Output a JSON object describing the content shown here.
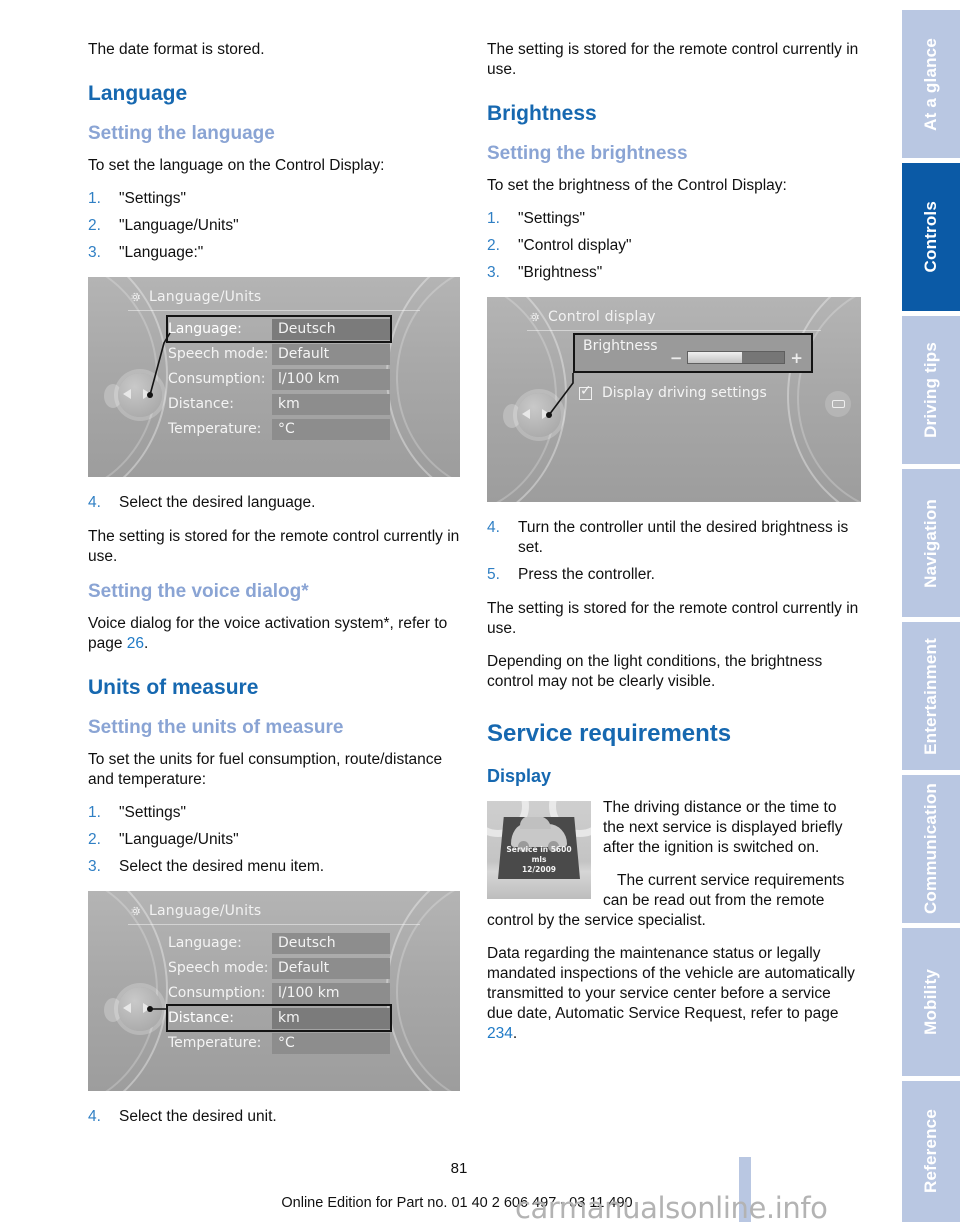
{
  "page_number": "81",
  "edition_line": "Online Edition for Part no. 01 40 2 606 497 - 03 11 490",
  "watermark": "carmanualsonline.info",
  "colors": {
    "heading_blue": "#1668b0",
    "subheading_light_blue": "#8aa4d4",
    "tab_inactive": "#b9c7e2",
    "tab_active": "#0b5aa6",
    "step_number": "#2f7fc4",
    "page_ref_link": "#1f7ac6"
  },
  "tabs": [
    {
      "label": "At a glance",
      "active": false
    },
    {
      "label": "Controls",
      "active": true
    },
    {
      "label": "Driving tips",
      "active": false
    },
    {
      "label": "Navigation",
      "active": false
    },
    {
      "label": "Entertainment",
      "active": false
    },
    {
      "label": "Communication",
      "active": false
    },
    {
      "label": "Mobility",
      "active": false
    },
    {
      "label": "Reference",
      "active": false
    }
  ],
  "left_column": {
    "intro": "The date format is stored.",
    "language_heading": "Language",
    "setting_language_heading": "Setting the language",
    "setting_language_lead": "To set the language on the Control Display:",
    "setting_language_steps": [
      {
        "num": "1.",
        "text": "\"Settings\""
      },
      {
        "num": "2.",
        "text": "\"Language/Units\""
      },
      {
        "num": "3.",
        "text": "\"Language:\""
      }
    ],
    "figure1": {
      "title": "Language/Units",
      "icon": "gear-icon",
      "rows": [
        {
          "label": "Language:",
          "value": "Deutsch",
          "selected": true
        },
        {
          "label": "Speech mode:",
          "value": "Default",
          "selected": false
        },
        {
          "label": "Consumption:",
          "value": "l/100 km",
          "selected": false
        },
        {
          "label": "Distance:",
          "value": "km",
          "selected": false
        },
        {
          "label": "Temperature:",
          "value": "°C",
          "selected": false
        }
      ]
    },
    "step4_language": {
      "num": "4.",
      "text": "Select the desired language."
    },
    "stored_note": "The setting is stored for the remote control currently in use.",
    "voice_dialog_heading": "Setting the voice dialog*",
    "voice_dialog_text_a": "Voice dialog for the voice activation system*, refer to page ",
    "voice_dialog_ref": "26",
    "voice_dialog_text_b": ".",
    "units_heading": "Units of measure",
    "setting_units_heading": "Setting the units of measure",
    "setting_units_lead": "To set the units for fuel consumption, route/distance and temperature:",
    "setting_units_steps": [
      {
        "num": "1.",
        "text": "\"Settings\""
      },
      {
        "num": "2.",
        "text": "\"Language/Units\""
      },
      {
        "num": "3.",
        "text": "Select the desired menu item."
      }
    ],
    "figure2": {
      "title": "Language/Units",
      "icon": "gear-icon",
      "rows": [
        {
          "label": "Language:",
          "value": "Deutsch",
          "selected": false
        },
        {
          "label": "Speech mode:",
          "value": "Default",
          "selected": false
        },
        {
          "label": "Consumption:",
          "value": "l/100 km",
          "selected": false
        },
        {
          "label": "Distance:",
          "value": "km",
          "selected": true
        },
        {
          "label": "Temperature:",
          "value": "°C",
          "selected": false
        }
      ]
    },
    "step4_units": {
      "num": "4.",
      "text": "Select the desired unit."
    }
  },
  "right_column": {
    "stored_note_top": "The setting is stored for the remote control currently in use.",
    "brightness_heading": "Brightness",
    "setting_brightness_heading": "Setting the brightness",
    "setting_brightness_lead": "To set the brightness of the Control Display:",
    "setting_brightness_steps": [
      {
        "num": "1.",
        "text": "\"Settings\""
      },
      {
        "num": "2.",
        "text": "\"Control display\""
      },
      {
        "num": "3.",
        "text": "\"Brightness\""
      }
    ],
    "figure3": {
      "title": "Control display",
      "icon": "gear-icon",
      "brightness_label": "Brightness",
      "minus": "−",
      "plus": "+",
      "slider_fill_percent": 56,
      "checkbox_label": "Display driving settings",
      "checkbox_checked": true
    },
    "brightness_steps_after": [
      {
        "num": "4.",
        "text": "Turn the controller until the desired brightness is set."
      },
      {
        "num": "5.",
        "text": "Press the controller."
      }
    ],
    "stored_note_bottom": "The setting is stored for the remote control currently in use.",
    "light_conditions_note": "Depending on the light conditions, the brightness control may not be clearly visible.",
    "service_heading": "Service requirements",
    "display_heading": "Display",
    "service_figure": {
      "line1": "Service in 5600 mls",
      "line2": "12/2009"
    },
    "display_para1": "The driving distance or the time to the next service is displayed briefly after the ignition is switched on.",
    "display_para2": "The current service requirements can be read out from the remote control by the service specialist.",
    "display_para3_a": "Data regarding the maintenance status or legally mandated inspections of the vehicle are automatically transmitted to your service center before a service due date, Automatic Service Request, refer to page ",
    "display_para3_ref": "234",
    "display_para3_b": "."
  }
}
